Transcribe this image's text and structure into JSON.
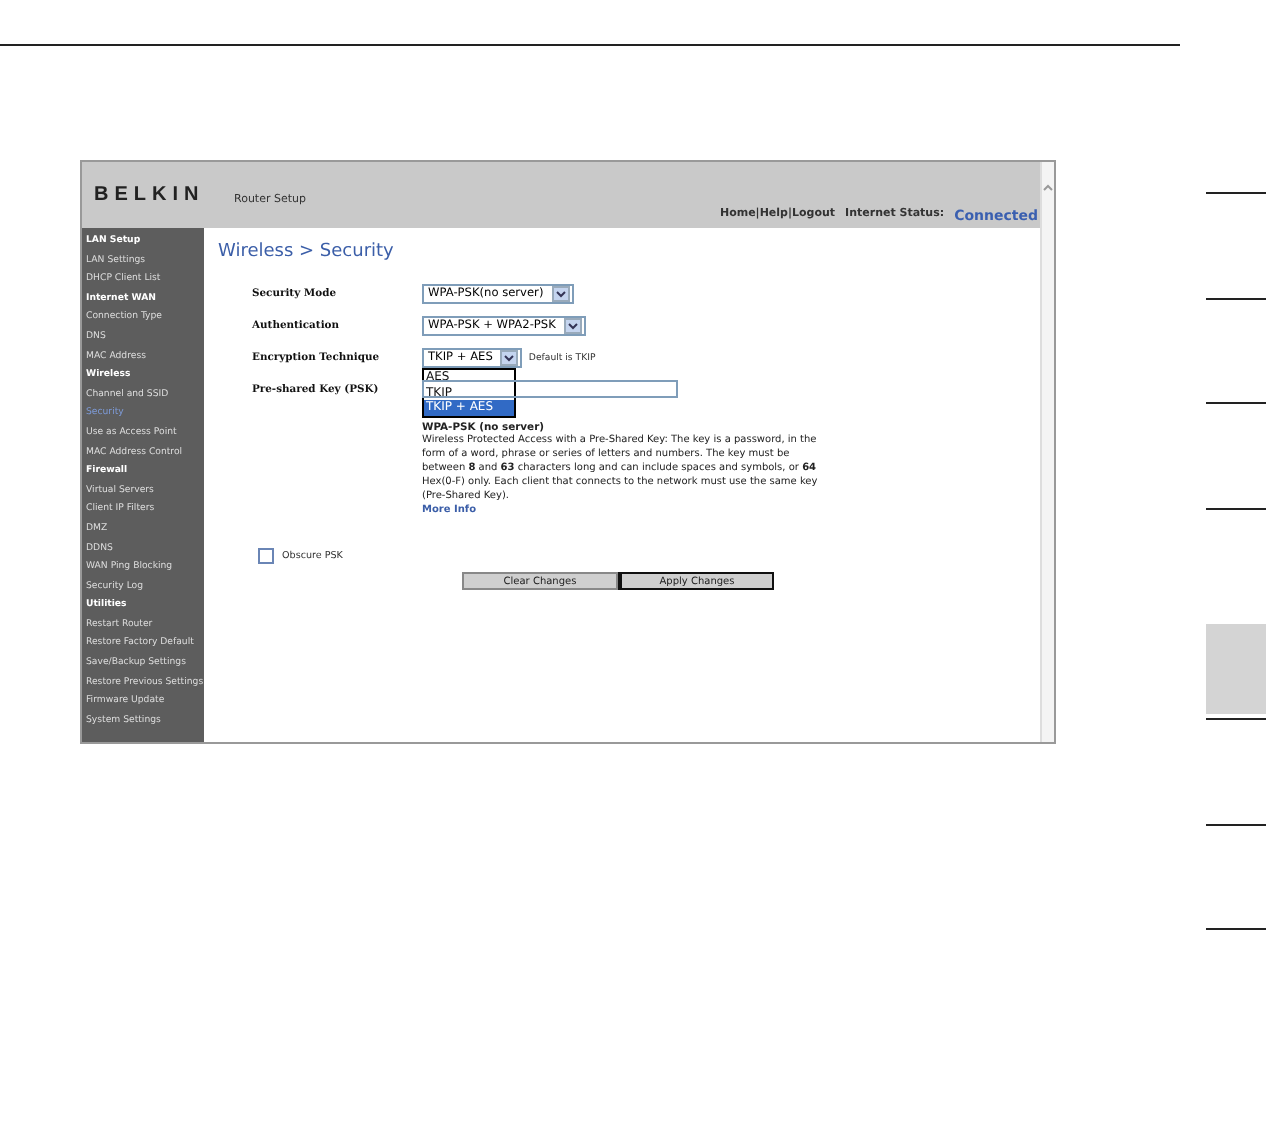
{
  "page_tabs": [
    {
      "selected": false
    },
    {
      "selected": false
    },
    {
      "selected": false
    },
    {
      "selected": false
    },
    {
      "selected": true
    },
    {
      "selected": false
    },
    {
      "selected": false
    },
    {
      "selected": false
    }
  ],
  "router": {
    "logo": "BELKIN",
    "header_title": "Router Setup",
    "header_links": "Home|Help|Logout",
    "status_label": "Internet Status:",
    "status_value": "Connected",
    "sidebar": [
      {
        "label": "LAN Setup",
        "kind": "header",
        "selected": false
      },
      {
        "label": "LAN Settings",
        "kind": "item",
        "selected": false
      },
      {
        "label": "DHCP Client List",
        "kind": "item",
        "selected": false
      },
      {
        "label": "Internet WAN",
        "kind": "header",
        "selected": false
      },
      {
        "label": "Connection Type",
        "kind": "item",
        "selected": false
      },
      {
        "label": "DNS",
        "kind": "item",
        "selected": false
      },
      {
        "label": "MAC Address",
        "kind": "item",
        "selected": false
      },
      {
        "label": "Wireless",
        "kind": "header",
        "selected": false
      },
      {
        "label": "Channel and SSID",
        "kind": "item",
        "selected": false
      },
      {
        "label": "Security",
        "kind": "item",
        "selected": true
      },
      {
        "label": "Use as Access Point",
        "kind": "item",
        "selected": false
      },
      {
        "label": "MAC Address Control",
        "kind": "item",
        "selected": false
      },
      {
        "label": "Firewall",
        "kind": "header",
        "selected": false
      },
      {
        "label": "Virtual Servers",
        "kind": "item",
        "selected": false
      },
      {
        "label": "Client IP Filters",
        "kind": "item",
        "selected": false
      },
      {
        "label": "DMZ",
        "kind": "item",
        "selected": false
      },
      {
        "label": "DDNS",
        "kind": "item",
        "selected": false
      },
      {
        "label": "WAN Ping Blocking",
        "kind": "item",
        "selected": false
      },
      {
        "label": "Security Log",
        "kind": "item",
        "selected": false
      },
      {
        "label": "Utilities",
        "kind": "header",
        "selected": false
      },
      {
        "label": "Restart Router",
        "kind": "item",
        "selected": false
      },
      {
        "label": "Restore Factory Default",
        "kind": "item",
        "selected": false
      },
      {
        "label": "Save/Backup Settings",
        "kind": "item",
        "selected": false
      },
      {
        "label": "Restore Previous Settings",
        "kind": "item",
        "selected": false
      },
      {
        "label": "Firmware Update",
        "kind": "item",
        "selected": false
      },
      {
        "label": "System Settings",
        "kind": "item",
        "selected": false
      }
    ],
    "page_title": "Wireless > Security",
    "fields": [
      {
        "label": "Security Mode",
        "kind": "select",
        "value": "WPA-PSK(no server)"
      },
      {
        "label": "Authentication",
        "kind": "select",
        "value": "WPA-PSK + WPA2-PSK"
      },
      {
        "label": "Encryption Technique",
        "kind": "select",
        "value": "TKIP + AES",
        "note": "Default is TKIP",
        "expanded": true,
        "options": [
          {
            "label": "AES",
            "selected": false
          },
          {
            "label": "TKIP",
            "selected": false
          },
          {
            "label": "TKIP + AES",
            "selected": true
          }
        ]
      },
      {
        "label": "Pre-shared Key (PSK)",
        "kind": "text"
      }
    ],
    "description": {
      "title": "WPA-PSK (no server)",
      "text": "Wireless Protected Access with a Pre-Shared Key: The key is a password, in the form of a word, phrase or series of letters and numbers. The key must be between **8** and **63** characters long and can include spaces and symbols, or **64** Hex(0-F) only. Each client that connects to the network must use the same key (Pre-Shared Key).",
      "link": "More Info"
    },
    "obscure_psk": {
      "label": "Obscure PSK",
      "checked": false
    },
    "buttons": [
      {
        "label": "Clear Changes",
        "default": false
      },
      {
        "label": "Apply Changes",
        "default": true
      }
    ]
  }
}
